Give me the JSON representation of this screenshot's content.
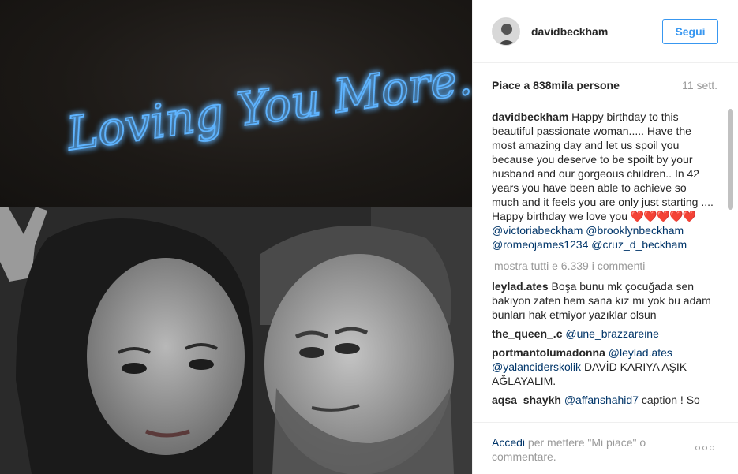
{
  "post": {
    "username": "davidbeckham",
    "follow_label": "Segui",
    "likes_text": "Piace a 838mila persone",
    "time_text": "11 sett.",
    "caption": {
      "username": "davidbeckham",
      "text": "Happy birthday to this beautiful passionate woman..... Have the most amazing day and let us spoil you because you deserve to be spoilt by your husband and our gorgeous children.. In 42 years you have been able to achieve so much and it feels you are only just starting .... Happy birthday we love you",
      "hearts": "❤️❤️❤️❤️❤️",
      "mentions": [
        "@victoriabeckham",
        "@brooklynbeckham",
        "@romeojames1234",
        "@cruz_d_beckham"
      ]
    },
    "show_all_comments": "mostra tutti e 6.339 i commenti",
    "comments": [
      {
        "username": "leylad.ates",
        "text": "Boşa bunu mk çocuğada sen bakıyon zaten hem sana kız mı yok bu adam bunları hak etmiyor yazıklar olsun"
      },
      {
        "username": "the_queen_.c",
        "mention": "@une_brazzareine"
      },
      {
        "username": "portmantolumadonna",
        "mention": "@leylad.ates",
        "mention2": "@yalanciderskolik",
        "text": "DAVİD KARIYA AŞIK AĞLAYALIM."
      },
      {
        "username": "aqsa_shaykh",
        "mention": "@affanshahid7",
        "text": "caption ! So"
      }
    ],
    "footer": {
      "login_link": "Accedi",
      "login_text": "per mettere \"Mi piace\" o commentare."
    },
    "photo": {
      "neon_text": "Loving You More."
    }
  },
  "colors": {
    "follow_blue": "#3897f0",
    "mention_blue": "#003569",
    "neon_blue": "#4aa8ff",
    "muted_gray": "#999999"
  },
  "icons": {
    "more_options": "three-dots-icon"
  }
}
